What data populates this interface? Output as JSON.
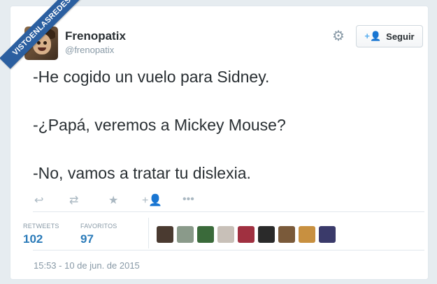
{
  "watermark": "VISTOENLASREDES",
  "user": {
    "name": "Frenopatix",
    "handle": "@frenopatix",
    "avatar_icon": "profile-photo"
  },
  "header": {
    "settings_icon": "gear-icon",
    "follow_label": "Seguir",
    "follow_icon": "add-user-icon"
  },
  "tweet": {
    "lines": [
      "-He cogido un vuelo para Sidney.",
      "-¿Papá, veremos a Mickey Mouse?",
      "-No, vamos a tratar tu dislexia."
    ]
  },
  "actions": [
    "reply-icon",
    "retweet-icon",
    "favorite-icon",
    "follow-icon",
    "more-icon"
  ],
  "stats": {
    "retweets_label": "RETWEETS",
    "retweets_value": "102",
    "favorites_label": "FAVORITOS",
    "favorites_value": "97"
  },
  "favoriters_colors": [
    "#4a3a30",
    "#8a9a8a",
    "#3a6a3a",
    "#c8c0b8",
    "#a03040",
    "#2a2a2a",
    "#7a5a3a",
    "#c89040",
    "#3a3a6a"
  ],
  "timestamp": "15:53 - 10 de jun. de 2015",
  "colors": {
    "accent": "#55acee",
    "stat_value": "#2b7bb9",
    "muted": "#8899a6",
    "text": "#292f33",
    "ribbon": "#2b5fa0"
  }
}
